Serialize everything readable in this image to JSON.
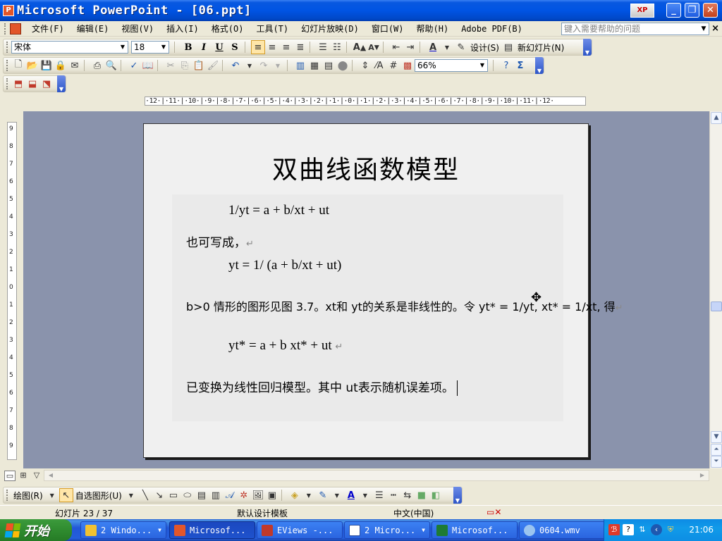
{
  "window": {
    "title": "Microsoft PowerPoint - [06.ppt]",
    "app_icon": "powerpoint-icon",
    "xp_logo": "XP",
    "controls": [
      "minimize-icon",
      "restore-icon",
      "close-icon"
    ]
  },
  "menu": {
    "items": [
      "文件(F)",
      "编辑(E)",
      "视图(V)",
      "插入(I)",
      "格式(O)",
      "工具(T)",
      "幻灯片放映(D)",
      "窗口(W)",
      "帮助(H)",
      "Adobe PDF(B)"
    ],
    "help_placeholder": "键入需要帮助的问题",
    "close_glyph": "×"
  },
  "format_toolbar": {
    "font": "宋体",
    "size": "18",
    "bold": "B",
    "italic": "I",
    "underline": "U",
    "shadow": "S",
    "font_color_label": "A",
    "design_label": "设计(S)",
    "new_slide_label": "新幻灯片(N)"
  },
  "standard_toolbar": {
    "zoom": "66%",
    "sigma": "Σ"
  },
  "ruler": {
    "horizontal": "·12·|·11·|·10·|·9·|·8·|·7·|·6·|·5·|·4·|·3·|·2·|·1·|·0·|·1·|·2·|·3·|·4·|·5·|·6·|·7·|·8·|·9·|·10·|·11·|·12·",
    "vertical": [
      "9",
      "8",
      "7",
      "6",
      "5",
      "4",
      "3",
      "2",
      "1",
      "0",
      "1",
      "2",
      "3",
      "4",
      "5",
      "6",
      "7",
      "8",
      "9"
    ]
  },
  "slide": {
    "title": "双曲线函数模型",
    "lines": [
      "1/yt = a + b/xt + ut",
      "也可写成，",
      "yt = 1/ (a + b/xt + ut)",
      "b>0 情形的图形见图 3.7。xt和 yt的关系是非线性的。令 yt* = 1/yt, xt* = 1/xt, 得",
      "yt* = a + b xt* + ut",
      "已变换为线性回归模型。其中 ut表示随机误差项。"
    ],
    "para_mark": "↵"
  },
  "draw_toolbar": {
    "draw_label": "绘图(R)",
    "autoshapes_label": "自选图形(U)"
  },
  "status": {
    "slide_indicator": "幻灯片 23 / 37",
    "template": "默认设计模板",
    "language": "中文(中国)"
  },
  "taskbar": {
    "start_label": "开始",
    "tasks": [
      "2 Windo...",
      "Microsof...",
      "EViews -...",
      "2 Micro...",
      "Microsof...",
      "0604.wmv"
    ],
    "clock": "21:06"
  },
  "colors": {
    "titlebar": "#0054e3",
    "taskbar": "#245edb",
    "workspace": "#8a93ac",
    "start_button": "#2f8b2f"
  }
}
